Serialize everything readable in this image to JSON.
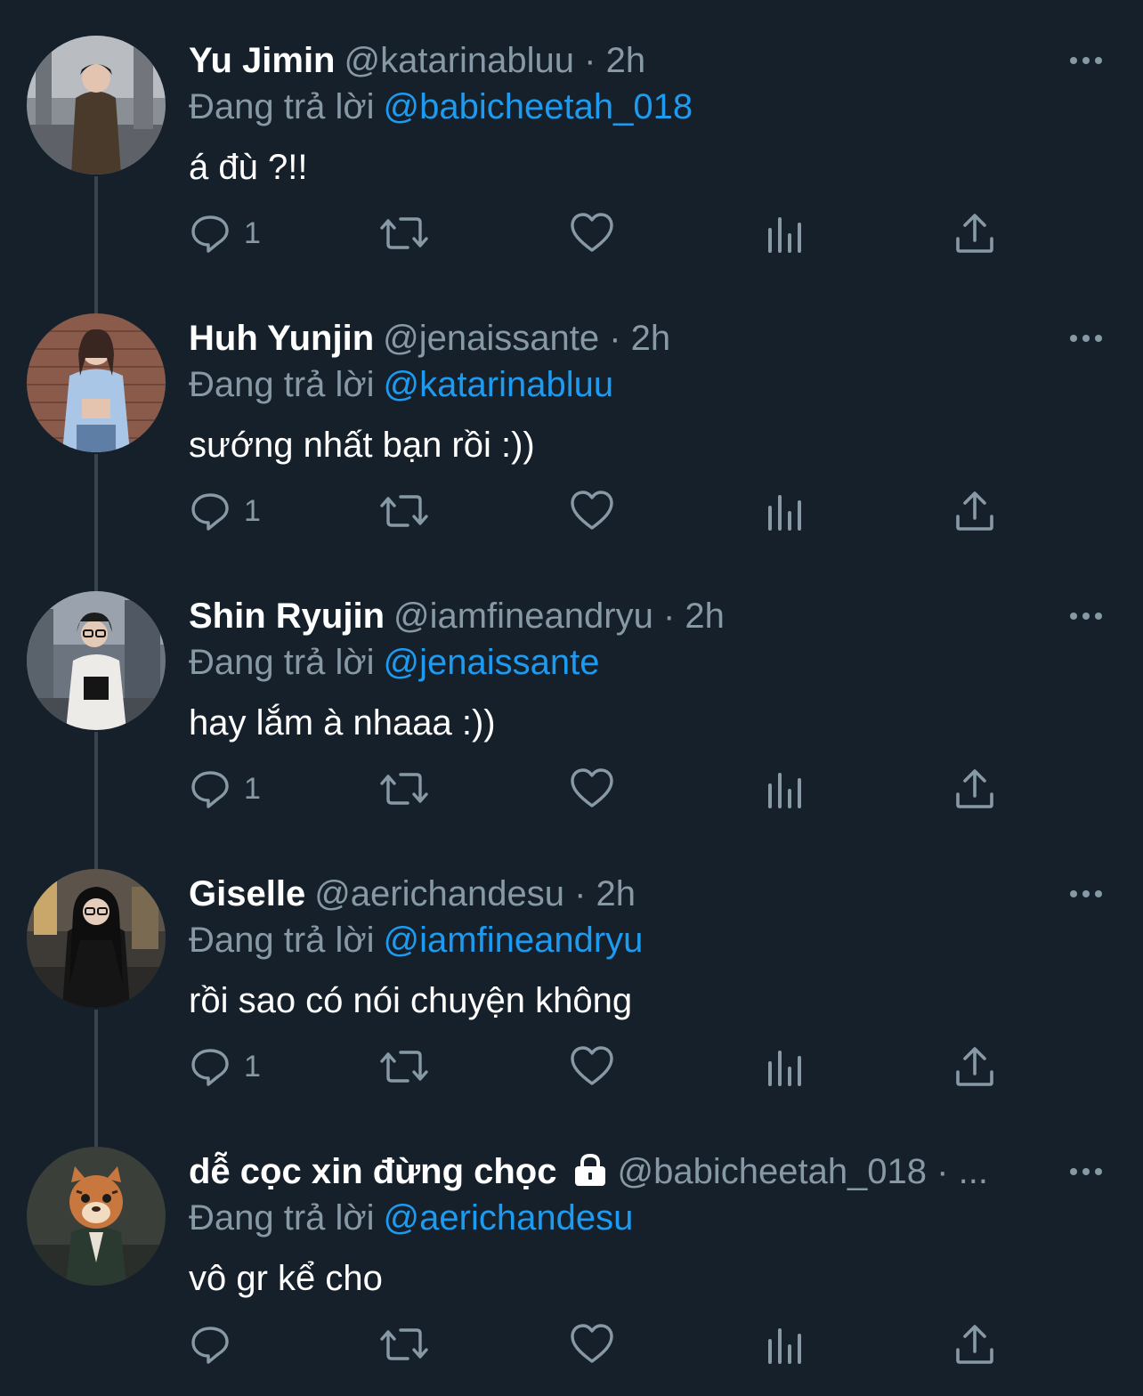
{
  "colors": {
    "background": "#15202b",
    "secondary_text": "#8899a6",
    "link": "#1d9bf0",
    "thread_line": "#38444d"
  },
  "reply_prefix": "Đang trả lời",
  "tweets": [
    {
      "name": "Yu Jimin",
      "handle": "@katarinabluu",
      "time": "2h",
      "meta": "@katarinabluu · 2h",
      "locked": false,
      "reply_to": "@babicheetah_018",
      "text": "á đù ?!!",
      "reply_count": "1",
      "avatar": "photo-woman-city-street"
    },
    {
      "name": "Huh Yunjin",
      "handle": "@jenaissante",
      "time": "2h",
      "meta": "@jenaissante · 2h",
      "locked": false,
      "reply_to": "@katarinabluu",
      "text": "sướng nhất bạn rồi :))",
      "reply_count": "1",
      "avatar": "photo-woman-brick-wall"
    },
    {
      "name": "Shin Ryujin",
      "handle": "@iamfineandryu",
      "time": "2h",
      "meta": "@iamfineandryu · 2h",
      "locked": false,
      "reply_to": "@jenaissante",
      "text": "hay lắm à nhaaa :))",
      "reply_count": "1",
      "avatar": "photo-woman-glasses-street"
    },
    {
      "name": "Giselle",
      "handle": "@aerichandesu",
      "time": "2h",
      "meta": "@aerichandesu · 2h",
      "locked": false,
      "reply_to": "@iamfineandryu",
      "text": "rồi sao có nói chuyện không",
      "reply_count": "1",
      "avatar": "photo-woman-long-hair-night"
    },
    {
      "name": "dễ cọc xin đừng chọc",
      "handle": "@babicheetah_018",
      "time": "",
      "meta": "@babicheetah_018 · ...",
      "locked": true,
      "reply_to": "@aerichandesu",
      "text": "vô gr kể cho",
      "reply_count": "",
      "avatar": "cartoon-tiger-suit"
    }
  ]
}
